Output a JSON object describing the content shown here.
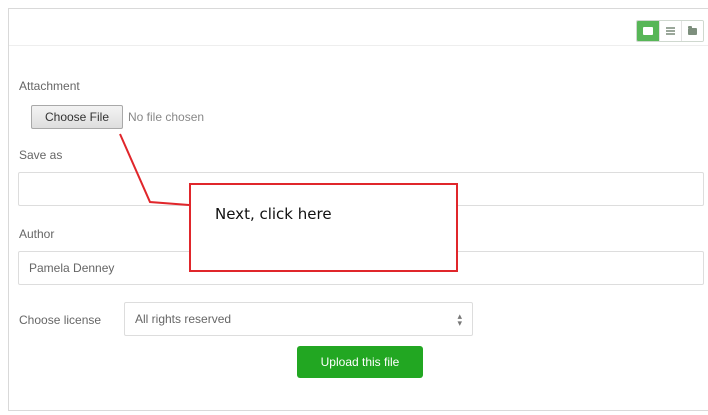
{
  "toolbar": {
    "view_buttons": [
      {
        "icon": "grid-view-icon",
        "active": true
      },
      {
        "icon": "list-view-icon",
        "active": false
      },
      {
        "icon": "folder-view-icon",
        "active": false
      }
    ],
    "active_color": "#57b657"
  },
  "form": {
    "attachment_label": "Attachment",
    "choose_file_label": "Choose File",
    "no_file_text": "No file chosen",
    "save_as_label": "Save as",
    "save_as_value": "",
    "author_label": "Author",
    "author_value": "Pamela Denney",
    "license_label": "Choose license",
    "license_value": "All rights reserved",
    "upload_label": "Upload this file",
    "upload_color": "#22a722"
  },
  "annotation": {
    "text": "Next, click here",
    "color": "#e0262b"
  }
}
